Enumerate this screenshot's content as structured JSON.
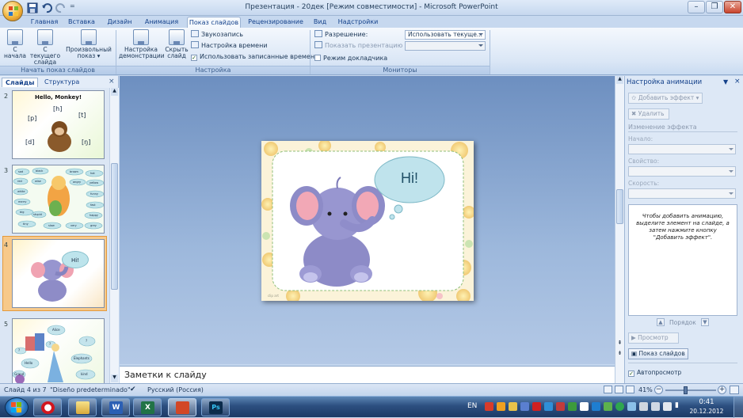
{
  "window": {
    "title": "Презентация - 20дек [Режим совместимости] - Microsoft PowerPoint",
    "controls": {
      "minimize": "–",
      "restore": "❐",
      "close": "✕"
    },
    "qat_more": "="
  },
  "ribbon": {
    "tabs": [
      "Главная",
      "Вставка",
      "Дизайн",
      "Анимация",
      "Показ слайдов",
      "Рецензирование",
      "Вид",
      "Надстройки"
    ],
    "active_tab": "Показ слайдов",
    "groups": {
      "start": {
        "label": "Начать показ слайдов",
        "from_start": "С начала",
        "from_current": "С текущего слайда",
        "custom": "Произвольный показ"
      },
      "setup": {
        "label": "Настройка",
        "setup_show": "Настройка демонстрации",
        "hide_slide": "Скрыть слайд",
        "record_narration": "Звукозапись",
        "rehearse": "Настройка времени",
        "use_timings": "Использовать записанные времена",
        "use_timings_checked": true
      },
      "monitors": {
        "label": "Мониторы",
        "resolution_label": "Разрешение:",
        "resolution_value": "Использовать текуще...",
        "show_on_label": "Показать презентацию на:",
        "presenter_view": "Режим докладчика",
        "presenter_view_checked": false
      }
    }
  },
  "left_pane": {
    "tabs": [
      "Слайды",
      "Структура"
    ],
    "active_tab": "Слайды",
    "close": "×",
    "slides": [
      {
        "num": "2",
        "title": "Hello, Monkey!",
        "sounds": [
          "[h]",
          "[p]",
          "[t]",
          "[d]",
          "[ŋ]"
        ]
      },
      {
        "num": "3",
        "bubbles": [
          "sad",
          "black",
          "brown",
          "hot",
          "red",
          "yellow",
          "white",
          "funny",
          "merry",
          "fast",
          "big",
          "happy",
          "tiny",
          "slow",
          "very",
          "grey",
          "wise",
          "angry",
          "stupid"
        ]
      },
      {
        "num": "4",
        "selected": true,
        "bubble": "Hi!"
      },
      {
        "num": "5",
        "bubbles": [
          "Alice",
          "?",
          "Elephants",
          "Hello",
          "?",
          "?",
          "Grand",
          "kind"
        ]
      }
    ]
  },
  "slide": {
    "bubble_text": "Hi!",
    "footer_mark": "clip art"
  },
  "notes": {
    "placeholder": "Заметки к слайду"
  },
  "right_pane": {
    "title": "Настройка анимации",
    "add_effect": "Добавить эффект",
    "remove": "Удалить",
    "change_effect": "Изменение эффекта",
    "start_label": "Начало:",
    "property_label": "Свойство:",
    "speed_label": "Скорость:",
    "hint": "Чтобы добавить анимацию, выделите элемент на слайде, а затем нажмите кнопку \"Добавить эффект\".",
    "order_label": "Порядок",
    "preview": "Просмотр",
    "slideshow": "Показ слайдов",
    "autopreview": "Автопросмотр",
    "autopreview_checked": true
  },
  "status": {
    "slide_info": "Слайд 4 из 7",
    "theme": "\"Diseño predeterminado\"",
    "language": "Русский (Россия)",
    "zoom": "41%",
    "zoom_fraction": 0.41
  },
  "taskbar": {
    "lang": "EN",
    "time": "0:41",
    "date": "20.12.2012",
    "apps": [
      "opera",
      "explorer",
      "word",
      "excel",
      "powerpoint",
      "photoshop"
    ],
    "word_glyph": "W",
    "excel_glyph": "X",
    "ps_glyph": "Ps"
  },
  "colors": {
    "ribbon_bg": "#dbe7f6",
    "accent_selected": "#f7c98a",
    "editor_bg": "#8aaad4",
    "taskbar": "#2c4f80"
  }
}
